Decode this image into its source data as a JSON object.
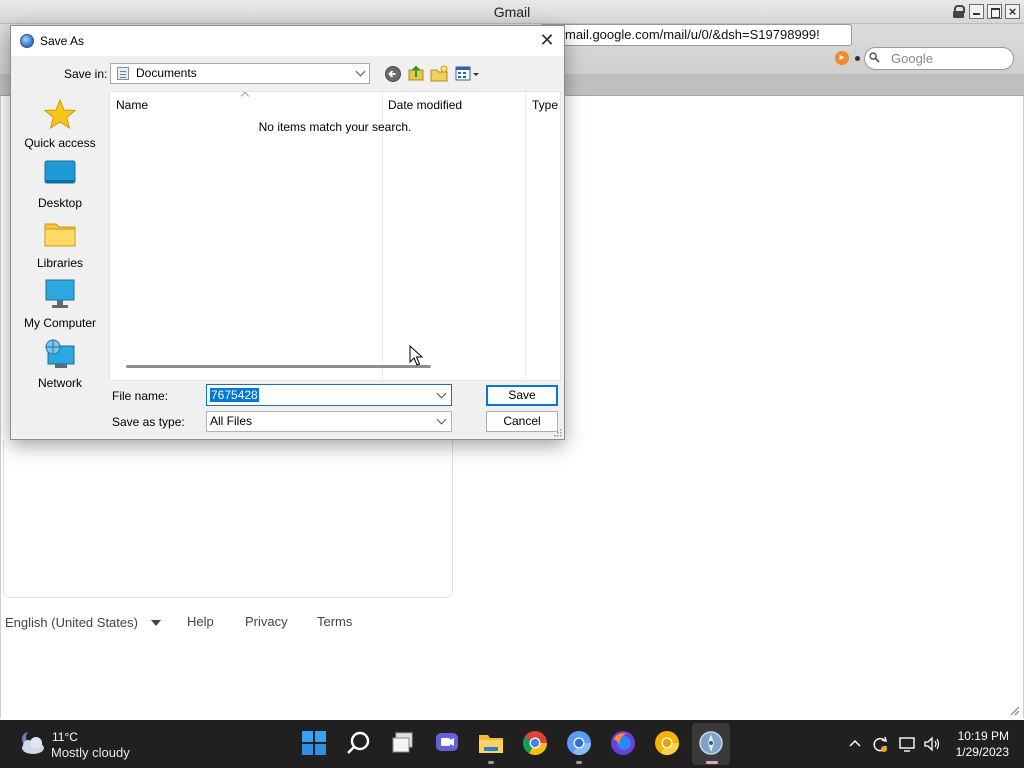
{
  "browser": {
    "title": "Gmail",
    "url": "mail.google.com/mail/u/0/&dsh=S19798999!",
    "search_placeholder": "Google",
    "url_badge": "▸"
  },
  "page": {
    "language": "English (United States)",
    "footer_links": [
      "Help",
      "Privacy",
      "Terms"
    ]
  },
  "dialog": {
    "title": "Save As",
    "close_glyph": "✕",
    "save_in_label": "Save in:",
    "save_in_value": "Documents",
    "places": [
      {
        "label": "Quick access",
        "icon": "star-icon"
      },
      {
        "label": "Desktop",
        "icon": "desktop-icon"
      },
      {
        "label": "Libraries",
        "icon": "libraries-folder-icon"
      },
      {
        "label": "My Computer",
        "icon": "computer-monitor-icon"
      },
      {
        "label": "Network",
        "icon": "network-globe-icon"
      }
    ],
    "columns": [
      "Name",
      "Date modified",
      "Type"
    ],
    "empty_message": "No items match your search.",
    "file_name_label": "File name:",
    "file_name_value": "7675428",
    "save_as_type_label": "Save as type:",
    "save_as_type_value": "All Files",
    "save_button": "Save",
    "cancel_button": "Cancel"
  },
  "taskbar": {
    "weather_temp": "11°C",
    "weather_desc": "Mostly cloudy",
    "apps": [
      "start-icon",
      "search-icon",
      "task-view-icon",
      "teams-chat-icon",
      "file-explorer-icon",
      "chrome-icon",
      "chromium-icon",
      "firefox-icon",
      "chrome-canary-icon",
      "browser-app-icon"
    ],
    "time": "10:19 PM",
    "date": "1/29/2023"
  },
  "colors": {
    "selection": "#0078d7",
    "taskbar_bg": "#202020",
    "dialog_bg": "#f0f0f0"
  }
}
